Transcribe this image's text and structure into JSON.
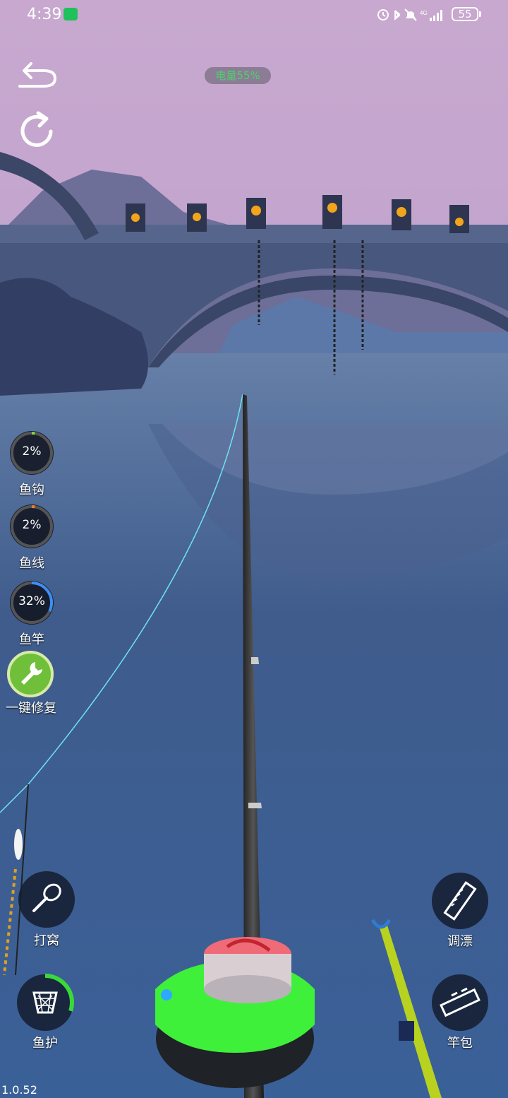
{
  "status_bar": {
    "time": "4:39",
    "battery": "55",
    "network": "4G"
  },
  "hud": {
    "battery_pill": "电量55%",
    "back_icon": "back-arrow-icon",
    "refresh_icon": "refresh-icon"
  },
  "durability": {
    "hook": {
      "value": "2%",
      "label": "鱼钩",
      "level": 0.02,
      "color": "#8ad13a"
    },
    "line": {
      "value": "2%",
      "label": "鱼线",
      "level": 0.02,
      "color": "#f07a2a"
    },
    "rod": {
      "value": "32%",
      "label": "鱼竿",
      "level": 0.32,
      "color": "#3d8df5"
    },
    "repair": {
      "label": "一键修复",
      "icon": "wrench-icon"
    }
  },
  "tools": {
    "bait": {
      "label": "打窝",
      "icon": "scoop-icon"
    },
    "net": {
      "label": "鱼护",
      "icon": "fish-net-icon",
      "level": 0.3
    },
    "float": {
      "label": "调漂",
      "icon": "ruler-icon"
    },
    "bag": {
      "label": "竿包",
      "icon": "rod-bag-icon"
    }
  },
  "version": "1.0.52",
  "colors": {
    "sky": "#c4a6cc",
    "water": "#3e5f92",
    "line": "#6fe2f2",
    "bait_box": "#3ff03a"
  }
}
